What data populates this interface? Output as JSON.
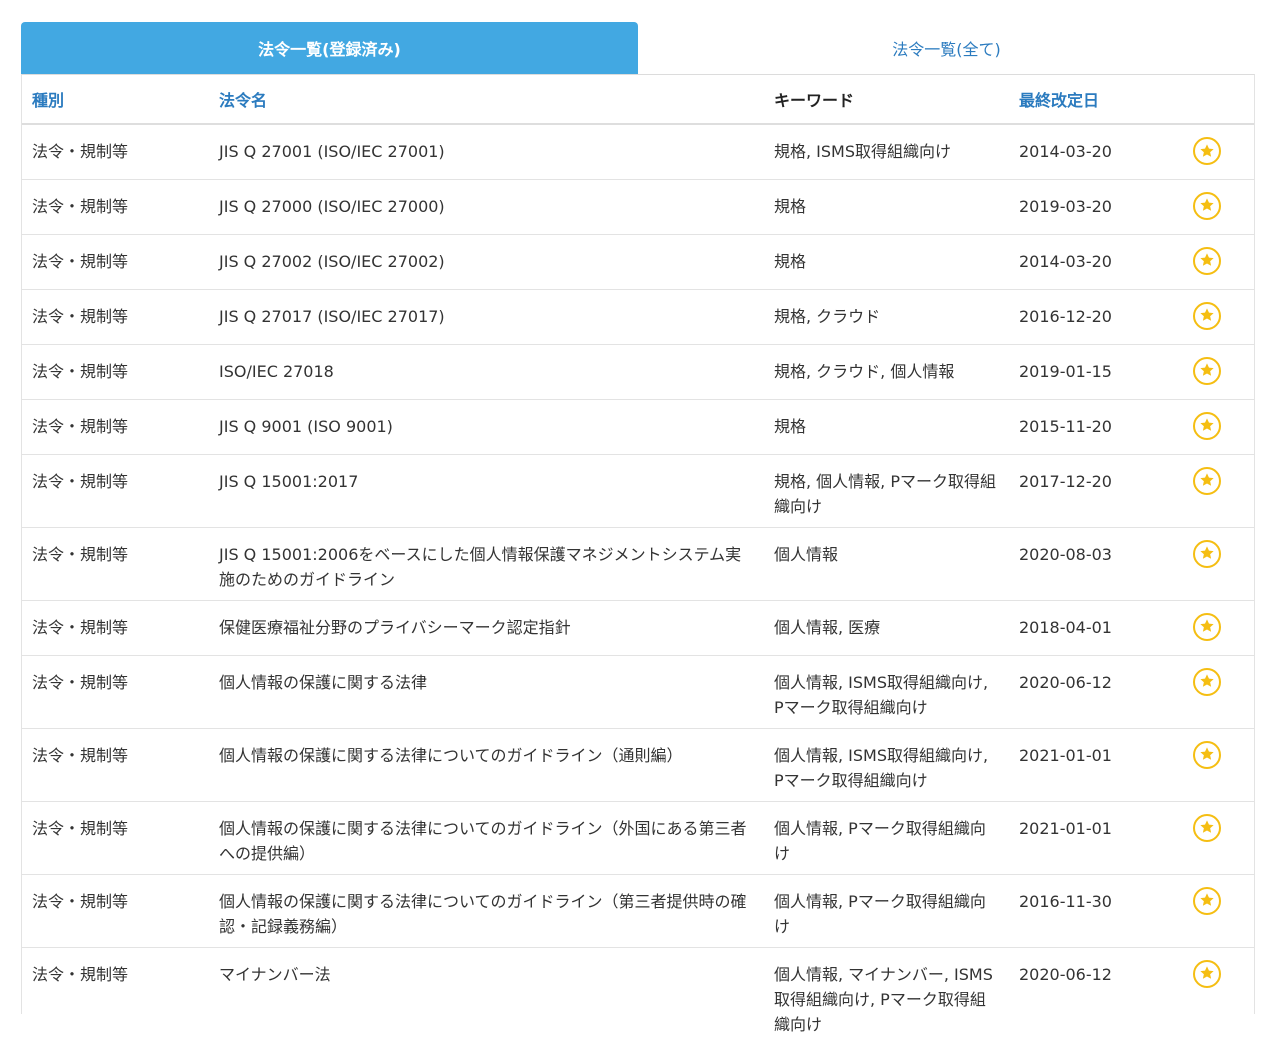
{
  "tabs": [
    {
      "label": "法令一覧(登録済み)",
      "active": true
    },
    {
      "label": "法令一覧(全て)",
      "active": false
    }
  ],
  "columns": {
    "type": "種別",
    "name": "法令名",
    "keyword": "キーワード",
    "date": "最終改定日"
  },
  "colors": {
    "active_tab": "#42a8e2",
    "link": "#2b7bbf",
    "star": "#f5be12"
  },
  "rows": [
    {
      "type": "法令・規制等",
      "name": "JIS Q 27001 (ISO/IEC 27001)",
      "keywords": "規格, ISMS取得組織向け",
      "date": "2014-03-20",
      "favorite": true
    },
    {
      "type": "法令・規制等",
      "name": "JIS Q 27000 (ISO/IEC 27000)",
      "keywords": "規格",
      "date": "2019-03-20",
      "favorite": true
    },
    {
      "type": "法令・規制等",
      "name": "JIS Q 27002 (ISO/IEC 27002)",
      "keywords": "規格",
      "date": "2014-03-20",
      "favorite": true
    },
    {
      "type": "法令・規制等",
      "name": "JIS Q 27017 (ISO/IEC 27017)",
      "keywords": "規格, クラウド",
      "date": "2016-12-20",
      "favorite": true
    },
    {
      "type": "法令・規制等",
      "name": "ISO/IEC 27018",
      "keywords": "規格, クラウド, 個人情報",
      "date": "2019-01-15",
      "favorite": true
    },
    {
      "type": "法令・規制等",
      "name": "JIS Q 9001 (ISO 9001)",
      "keywords": "規格",
      "date": "2015-11-20",
      "favorite": true
    },
    {
      "type": "法令・規制等",
      "name": "JIS Q 15001:2017",
      "keywords": "規格, 個人情報, Pマーク取得組織向け",
      "date": "2017-12-20",
      "favorite": true
    },
    {
      "type": "法令・規制等",
      "name": "JIS Q 15001:2006をベースにした個人情報保護マネジメントシステム実施のためのガイドライン",
      "keywords": "個人情報",
      "date": "2020-08-03",
      "favorite": true
    },
    {
      "type": "法令・規制等",
      "name": "保健医療福祉分野のプライバシーマーク認定指針",
      "keywords": "個人情報, 医療",
      "date": "2018-04-01",
      "favorite": true
    },
    {
      "type": "法令・規制等",
      "name": "個人情報の保護に関する法律",
      "keywords": "個人情報, ISMS取得組織向け, Pマーク取得組織向け",
      "date": "2020-06-12",
      "favorite": true
    },
    {
      "type": "法令・規制等",
      "name": "個人情報の保護に関する法律についてのガイドライン（通則編）",
      "keywords": "個人情報, ISMS取得組織向け, Pマーク取得組織向け",
      "date": "2021-01-01",
      "favorite": true
    },
    {
      "type": "法令・規制等",
      "name": "個人情報の保護に関する法律についてのガイドライン（外国にある第三者への提供編）",
      "keywords": "個人情報, Pマーク取得組織向け",
      "date": "2021-01-01",
      "favorite": true
    },
    {
      "type": "法令・規制等",
      "name": "個人情報の保護に関する法律についてのガイドライン（第三者提供時の確認・記録義務編）",
      "keywords": "個人情報, Pマーク取得組織向け",
      "date": "2016-11-30",
      "favorite": true
    },
    {
      "type": "法令・規制等",
      "name": "マイナンバー法",
      "keywords": "個人情報, マイナンバー, ISMS取得組織向け, Pマーク取得組織向け",
      "date": "2020-06-12",
      "favorite": true
    }
  ]
}
